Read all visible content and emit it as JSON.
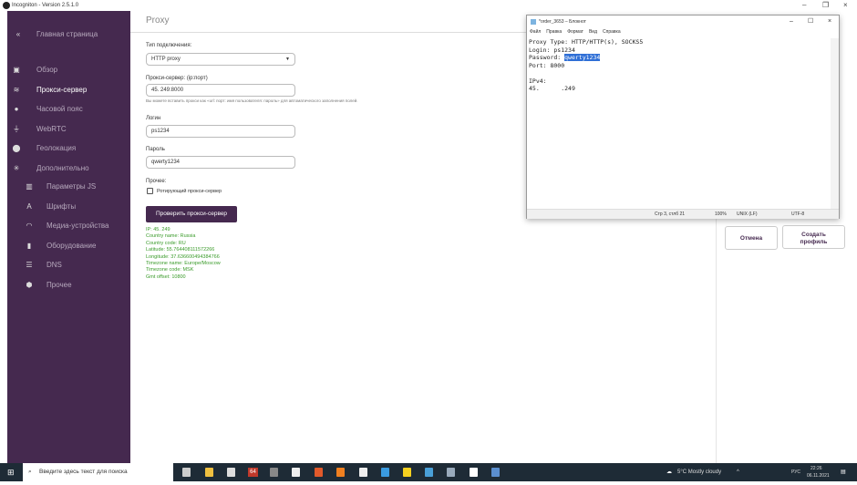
{
  "window": {
    "title": "Incogniton - Version 2.5.1.0"
  },
  "sidebar": {
    "home": "Главная страница",
    "items": [
      {
        "label": "Обзор",
        "icon": "id-card-icon",
        "glyph": "▣"
      },
      {
        "label": "Прокси-сервер",
        "icon": "wifi-icon",
        "glyph": "≋"
      },
      {
        "label": "Часовой пояс",
        "icon": "clock-icon",
        "glyph": "●"
      },
      {
        "label": "WebRTC",
        "icon": "plug-icon",
        "glyph": "⏚"
      },
      {
        "label": "Геолокация",
        "icon": "location-pin-icon",
        "glyph": "⬤"
      },
      {
        "label": "Дополнительно",
        "icon": "asterisk-icon",
        "glyph": "✳"
      }
    ],
    "subitems": [
      {
        "label": "Параметры JS",
        "icon": "map-icon",
        "glyph": "▥"
      },
      {
        "label": "Шрифты",
        "icon": "font-icon",
        "glyph": "A"
      },
      {
        "label": "Медиа-устройства",
        "icon": "headphones-icon",
        "glyph": "◠"
      },
      {
        "label": "Оборудование",
        "icon": "hardware-icon",
        "glyph": "▮"
      },
      {
        "label": "DNS",
        "icon": "dns-icon",
        "glyph": "☰"
      },
      {
        "label": "Прочее",
        "icon": "cube-icon",
        "glyph": "⬢"
      }
    ]
  },
  "main": {
    "title": "Proxy",
    "conn_type_label": "Тип подключения:",
    "conn_type_value": "HTTP proxy",
    "proxy_label": "Прокси-сервер: (ip:порт)",
    "proxy_value": "45.        249:8000",
    "proxy_hint": "Вы можете вставить прокси как «url: порт: имя пользователя: пароль» для автоматического заполнения полей.",
    "login_label": "Логин",
    "login_value": "ps1234",
    "password_label": "Пароль",
    "password_value": "qwerty1234",
    "other_label": "Прочее:",
    "rotating_label": "Ротирующий прокси-сервер",
    "check_button": "Проверить прокси-сервер",
    "result": [
      "IP: 45.          249",
      "Country name: Russia",
      "Country code: RU",
      "Latitude: 55.764408111572266",
      "Longitude: 37.63660049438476​6",
      "Timezone name: Europe/Moscow",
      "Timezone code: MSK",
      "Gmt offset: 10800"
    ],
    "cancel": "Отмена",
    "create": "Создать профиль"
  },
  "notepad": {
    "title": "*order_3653 – Блокнот",
    "menu": [
      "Файл",
      "Правка",
      "Формат",
      "Вид",
      "Справка"
    ],
    "line1": "Proxy Type: HTTP/HTTP(s), SOCKS5",
    "line2": "Login: ps1234",
    "line3_prefix": "Password: ",
    "line3_sel": "qwerty1234",
    "line4": "Port: 8000",
    "line5": "",
    "line6": "IPv4:",
    "line7": "45.      .249",
    "status": {
      "pos": "Стр 3, стлб 21",
      "zoom": "100%",
      "eol": "UNIX (LF)",
      "enc": "UTF-8"
    }
  },
  "taskbar": {
    "search_placeholder": "Введите здесь текст для поиска",
    "weather": "5°C  Mostly cloudy",
    "lang": "РУС",
    "time": "22:26",
    "date": "06.11.2021",
    "badge": "64"
  }
}
